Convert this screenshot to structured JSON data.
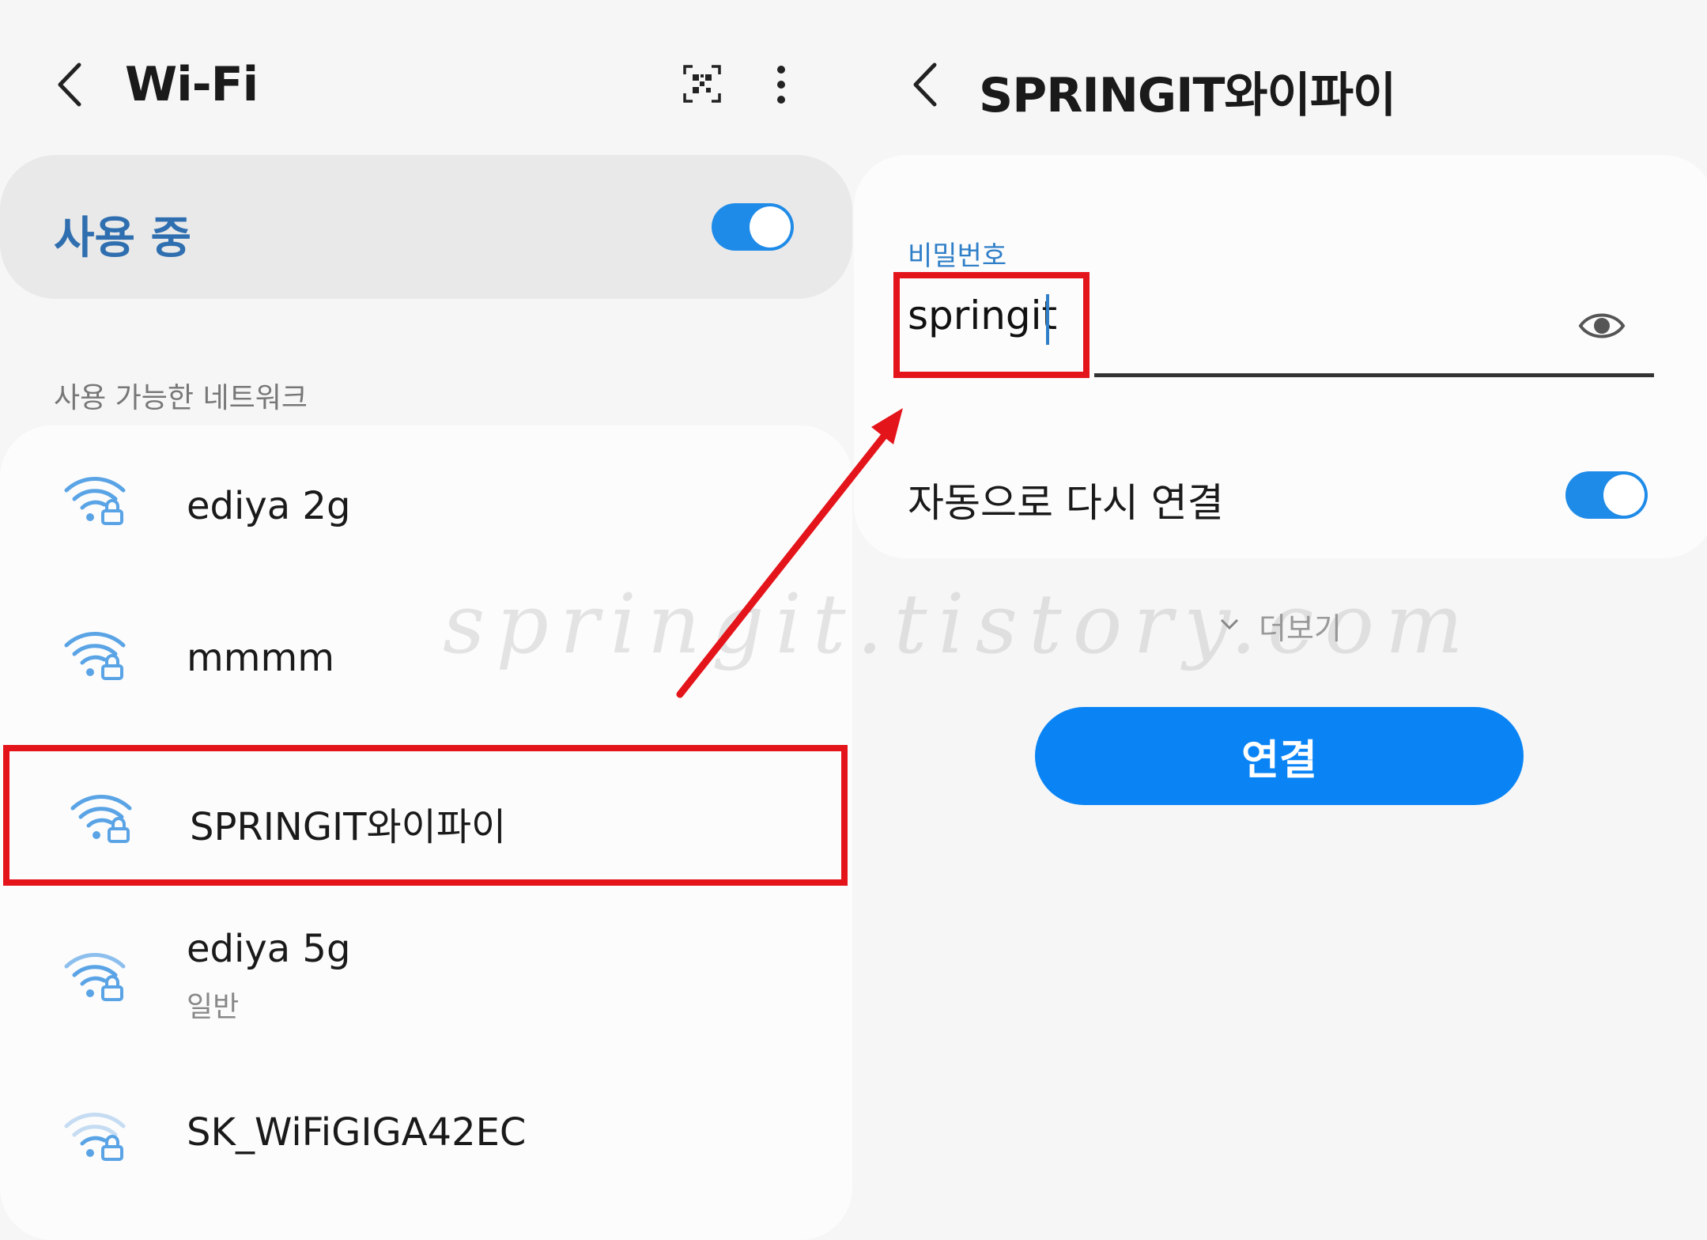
{
  "left": {
    "header": {
      "title": "Wi-Fi",
      "back_icon": "chevron-left-icon",
      "qr_icon": "qr-scan-icon",
      "menu_icon": "more-vertical-icon"
    },
    "master_toggle": {
      "label": "사용 중",
      "on": true
    },
    "section_label": "사용 가능한 네트워크",
    "networks": [
      {
        "name": "ediya 2g",
        "subtitle": "",
        "icon": "wifi-lock-icon"
      },
      {
        "name": "mmmm",
        "subtitle": "",
        "icon": "wifi-lock-icon"
      },
      {
        "name": "SPRINGIT와이파이",
        "subtitle": "",
        "icon": "wifi-lock-icon",
        "highlighted": true
      },
      {
        "name": "ediya 5g",
        "subtitle": "일반",
        "icon": "wifi-lock-icon"
      },
      {
        "name": "SK_WiFiGIGA42EC",
        "subtitle": "",
        "icon": "wifi-lock-icon"
      }
    ]
  },
  "right": {
    "header": {
      "title": "SPRINGIT와이파이",
      "back_icon": "chevron-left-icon"
    },
    "password": {
      "label": "비밀번호",
      "value": "springit",
      "eye_icon": "eye-icon"
    },
    "auto_reconnect": {
      "label": "자동으로 다시 연결",
      "on": true
    },
    "more_label": "더보기",
    "connect_label": "연결"
  },
  "watermark": "springit.tistory.com",
  "colors": {
    "accent": "#0a84f5",
    "toggle": "#1f8be8",
    "highlight": "#e4141b",
    "label_blue": "#2f7fc8",
    "wifi_icon": "#5aa4e6"
  }
}
